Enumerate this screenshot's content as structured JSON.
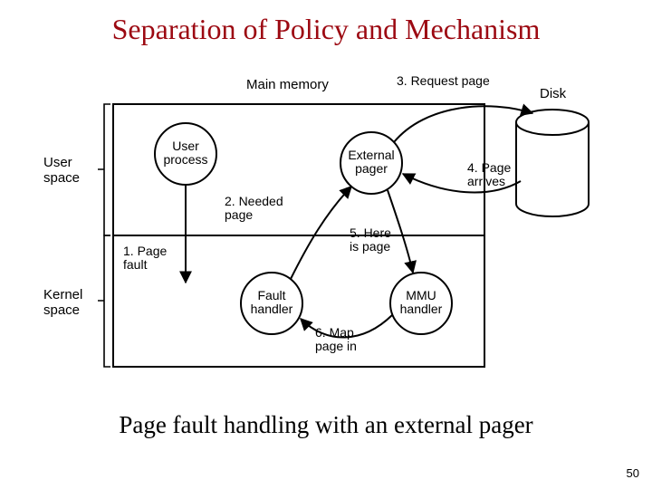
{
  "title": "Separation of Policy and Mechanism",
  "caption": "Page fault handling with an external pager",
  "page_number": "50",
  "labels": {
    "main_memory": "Main memory",
    "disk": "Disk",
    "user_space": "User\nspace",
    "kernel_space": "Kernel\nspace",
    "user_process": "User\nprocess",
    "external_pager": "External\npager",
    "fault_handler": "Fault\nhandler",
    "mmu_handler": "MMU\nhandler"
  },
  "steps": {
    "s1": "1. Page\nfault",
    "s2": "2. Needed\npage",
    "s3": "3. Request page",
    "s4": "4. Page\narrives",
    "s5": "5. Here\nis page",
    "s6": "6. Map\npage in"
  }
}
